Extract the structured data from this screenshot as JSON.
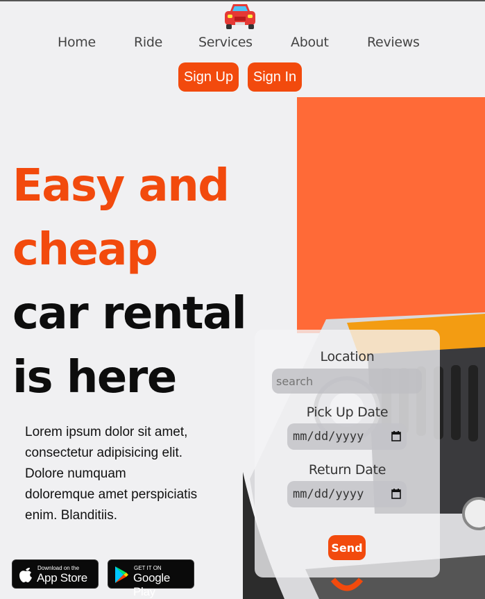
{
  "nav": {
    "items": [
      {
        "label": "Home"
      },
      {
        "label": "Ride"
      },
      {
        "label": "Services"
      },
      {
        "label": "About"
      },
      {
        "label": "Reviews"
      }
    ],
    "sign_up": "Sign Up",
    "sign_in": "Sign In"
  },
  "hero": {
    "line1": "Easy and",
    "line2": "cheap",
    "line3": "car rental",
    "line4": "is here",
    "description": "Lorem ipsum dolor sit amet, consectetur adipisicing elit. Dolore numquam doloremque amet perspiciatis enim. Blanditiis."
  },
  "stores": {
    "apple_small": "Download on the",
    "apple_big": "App Store",
    "google_small": "GET IT ON",
    "google_big": "Google Play"
  },
  "form": {
    "location_label": "Location",
    "search_placeholder": "search",
    "pickup_label": "Pick Up Date",
    "pickup_value": "mm/dd/yyyy",
    "return_label": "Return Date",
    "return_value": "mm/dd/yyyy",
    "send_label": "Send"
  },
  "icons": {
    "logo": "car-icon",
    "apple": "apple-icon",
    "google_play": "google-play-icon",
    "calendar": "calendar-icon"
  },
  "colors": {
    "accent": "#f24a0d",
    "panel": "#ff6a37",
    "background": "#f0f0f2"
  }
}
